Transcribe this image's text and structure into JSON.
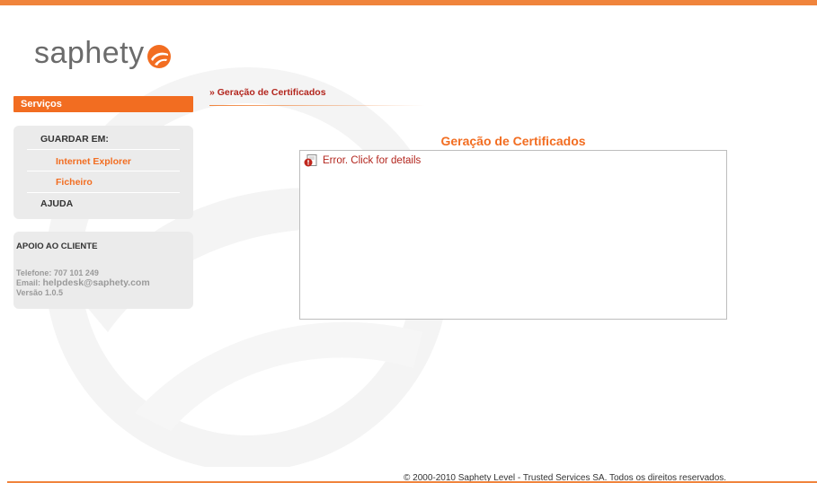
{
  "colors": {
    "accent": "#f26d21",
    "top_bar": "#f0843c",
    "error_red": "#b3261e",
    "panel_bg": "#ebebeb"
  },
  "logo": {
    "text": "saphety"
  },
  "sidebar": {
    "services_label": "Serviços",
    "menu": {
      "header": "GUARDAR EM:",
      "items": [
        {
          "label": "Internet Explorer"
        },
        {
          "label": "Ficheiro"
        }
      ],
      "help_label": "AJUDA"
    },
    "support": {
      "title": "APOIO AO CLIENTE",
      "phone": "Telefone: 707 101 249",
      "email_prefix": "Email: ",
      "email": "helpdesk@saphety.com",
      "version": "Versão 1.0.5"
    }
  },
  "main": {
    "breadcrumb": "» Geração de Certificados",
    "title": "Geração de Certificados",
    "error_link": "Error. Click for details",
    "error_icon": "error-page-icon"
  },
  "footer": {
    "text": "© 2000-2010 Saphety Level - Trusted Services SA. Todos os direitos reservados."
  }
}
